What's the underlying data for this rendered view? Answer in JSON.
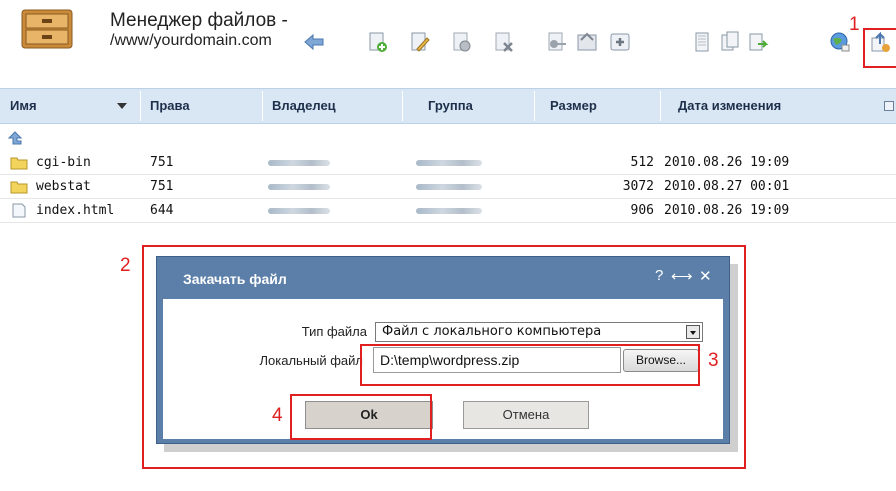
{
  "header": {
    "title_line1": "Менеджер файлов -",
    "title_line2": "/www/yourdomain.com"
  },
  "toolbar": {
    "icons": [
      "back-arrow-icon",
      "new-file-icon",
      "edit-file-icon",
      "properties-icon",
      "delete-file-icon",
      "permissions-icon",
      "archive-icon",
      "extract-icon",
      "copy-icon",
      "duplicate-icon",
      "move-icon",
      "download-url-icon",
      "upload-icon"
    ]
  },
  "table": {
    "columns": [
      "Имя",
      "Права",
      "Владелец",
      "Группа",
      "Размер",
      "Дата изменения"
    ],
    "rows": [
      {
        "name": "cgi-bin",
        "perms": "751",
        "size": "512",
        "date": "2010.08.26 19:09",
        "type": "folder"
      },
      {
        "name": "webstat",
        "perms": "751",
        "size": "3072",
        "date": "2010.08.27 00:01",
        "type": "folder"
      },
      {
        "name": "index.html",
        "perms": "644",
        "size": "906",
        "date": "2010.08.26 19:09",
        "type": "file"
      }
    ]
  },
  "dialog": {
    "title": "Закачать файл",
    "help_label": "?",
    "expand_label": "⟷",
    "close_label": "✕",
    "file_type_label": "Тип файла",
    "file_type_value": "Файл с локального компьютера",
    "local_file_label": "Локальный файл",
    "local_file_value": "D:\\temp\\wordpress.zip",
    "browse_label": "Browse...",
    "ok_label": "Ok",
    "cancel_label": "Отмена"
  },
  "callouts": [
    "1",
    "2",
    "3",
    "4"
  ],
  "colors": {
    "header_bg": "#d9e6f4",
    "dialog_title_bg": "#5b7fa8",
    "callout_red": "#e02020",
    "folder_yellow": "#f2d45c"
  }
}
